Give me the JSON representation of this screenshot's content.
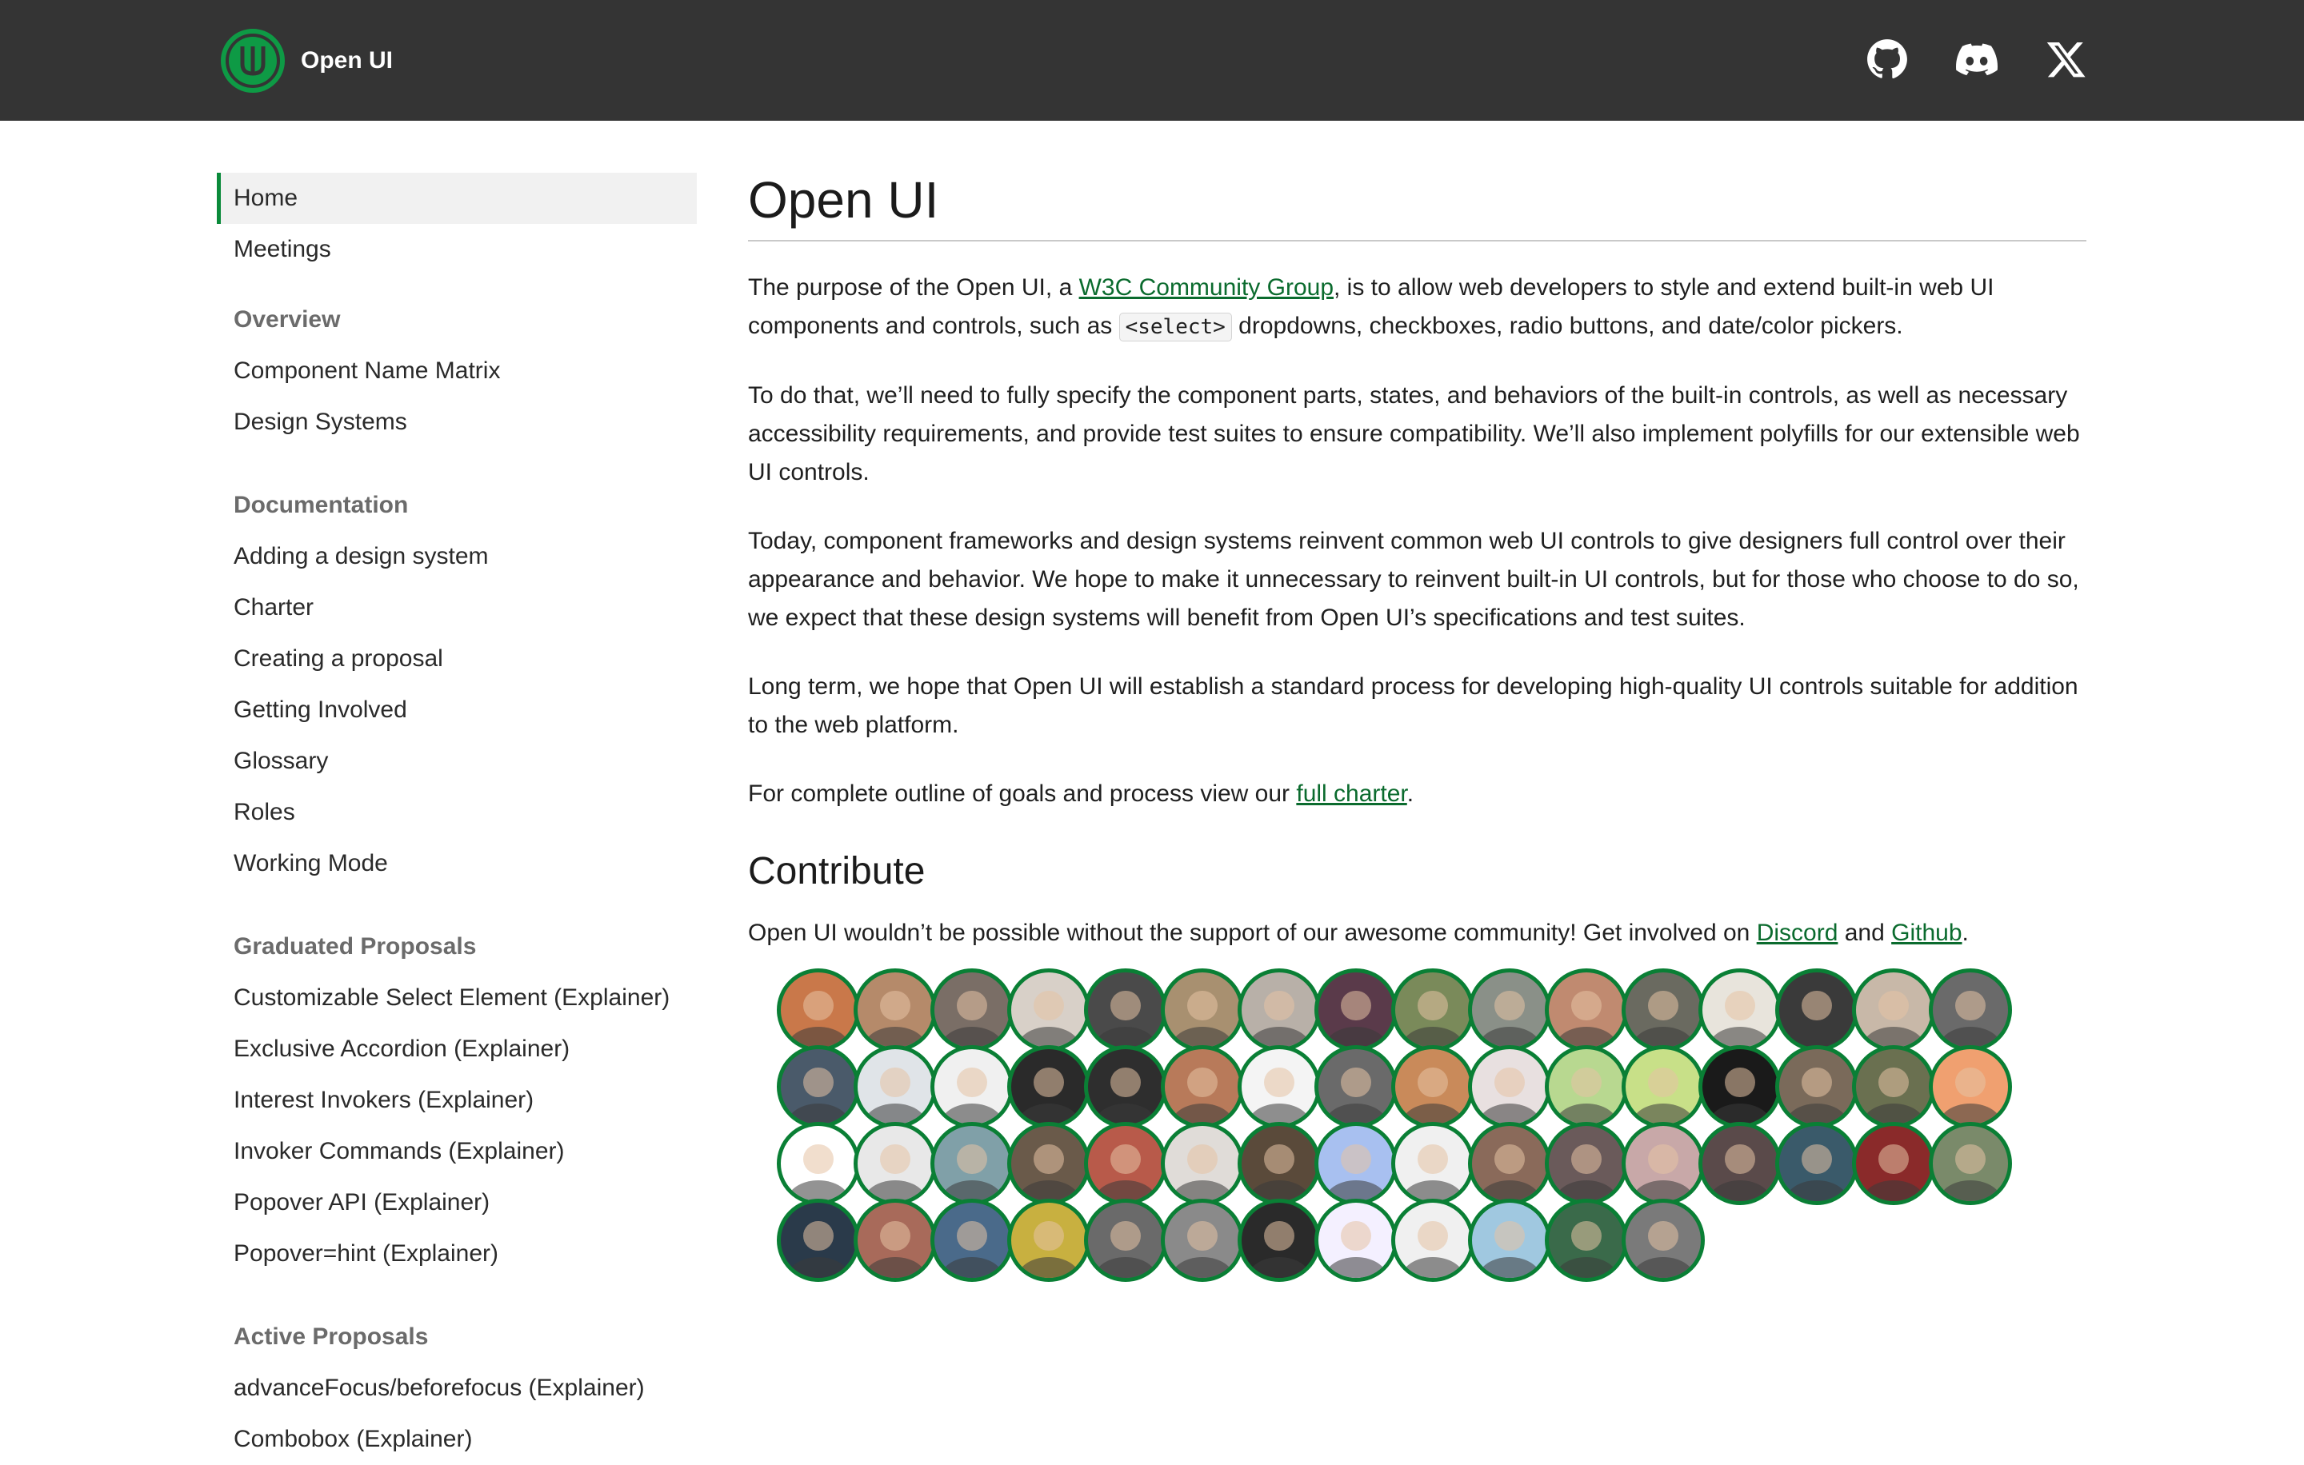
{
  "header": {
    "brand": "Open UI",
    "links": [
      {
        "name": "github-icon"
      },
      {
        "name": "discord-icon"
      },
      {
        "name": "x-icon"
      }
    ]
  },
  "sidebar": {
    "top": [
      "Home",
      "Meetings"
    ],
    "overview": {
      "heading": "Overview",
      "items": [
        "Component Name Matrix",
        "Design Systems"
      ]
    },
    "documentation": {
      "heading": "Documentation",
      "items": [
        "Adding a design system",
        "Charter",
        "Creating a proposal",
        "Getting Involved",
        "Glossary",
        "Roles",
        "Working Mode"
      ]
    },
    "graduated": {
      "heading": "Graduated Proposals",
      "items": [
        "Customizable Select Element (Explainer)",
        "Exclusive Accordion (Explainer)",
        "Interest Invokers (Explainer)",
        "Invoker Commands (Explainer)",
        "Popover API (Explainer)",
        "Popover=hint (Explainer)"
      ]
    },
    "active": {
      "heading": "Active Proposals",
      "items": [
        "advanceFocus/beforefocus (Explainer)",
        "Combobox (Explainer)"
      ]
    }
  },
  "main": {
    "title": "Open UI",
    "p1": {
      "a": "The purpose of the Open UI, a ",
      "link": "W3C Community Group",
      "b": ", is to allow web developers to style and extend built-in web UI components and controls, such as ",
      "code": "<select>",
      "c": " dropdowns, checkboxes, radio buttons, and date/color pickers."
    },
    "p2": "To do that, we’ll need to fully specify the component parts, states, and behaviors of the built-in controls, as well as necessary accessibility requirements, and provide test suites to ensure compatibility. We’ll also implement polyfills for our extensible web UI controls.",
    "p3": "Today, component frameworks and design systems reinvent common web UI controls to give designers full control over their appearance and behavior. We hope to make it unnecessary to reinvent built-in UI controls, but for those who choose to do so, we expect that these design systems will benefit from Open UI’s specifications and test suites.",
    "p4": "Long term, we hope that Open UI will establish a standard process for developing high-quality UI controls suitable for addition to the web platform.",
    "p5": {
      "a": "For complete outline of goals and process view our ",
      "link": "full charter",
      "b": "."
    },
    "contribute": {
      "title": "Contribute",
      "a": "Open UI wouldn’t be possible without the support of our awesome community! Get involved on ",
      "discord": "Discord",
      "mid": " and ",
      "github": "Github",
      "end": "."
    },
    "contributors": {
      "rows": [
        16,
        16,
        16,
        12
      ],
      "colors": [
        "#c9784a",
        "#b58a6a",
        "#7a6e66",
        "#d8d0c8",
        "#4a4a4a",
        "#a89070",
        "#b8b0a8",
        "#5a3a4a",
        "#7a8a5a",
        "#8a9088",
        "#c08a70",
        "#6a6a60",
        "#e8e4dc",
        "#3a3a3a",
        "#c8b8a8",
        "#6a6a6a",
        "#4a5a6a",
        "#e0e4e8",
        "#f0f0f0",
        "#2a2a2a",
        "#2e2e2e",
        "#b87a5a",
        "#f4f4f4",
        "#6a6a6a",
        "#c98a5a",
        "#e8e0e0",
        "#b8d890",
        "#c8e088",
        "#1a1a1a",
        "#7a6a5a",
        "#6a7050",
        "#f0a070",
        "#ffffff",
        "#e8e8e8",
        "#80a0a8",
        "#6a5a4a",
        "#b85a4a",
        "#e0dcd8",
        "#5a4a3a",
        "#a8c0f0",
        "#f0f0f0",
        "#8a6a5a",
        "#6a5a5a",
        "#c8a8a8",
        "#5a4a4a",
        "#3a5a6a",
        "#8a2a2a",
        "#7a8a6a",
        "#2a3a4a",
        "#a86a5a",
        "#4a6a8a",
        "#c8b040",
        "#6a6a6a",
        "#8a8a8a",
        "#2a2a2a",
        "#f4f0ff",
        "#f0f0f0",
        "#a0c8e0",
        "#3a6a4a",
        "#7a7a7a"
      ]
    }
  }
}
